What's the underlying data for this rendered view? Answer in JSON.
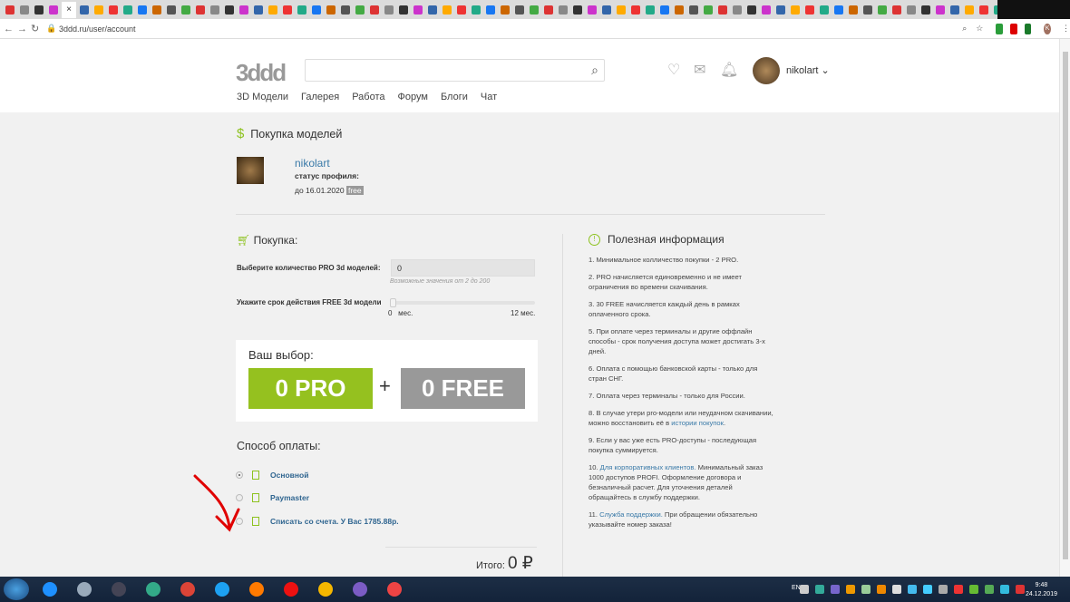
{
  "browser": {
    "url": "3ddd.ru/user/account",
    "active_tab_close": "×",
    "new_tab": "+",
    "profile_initial": "K"
  },
  "header": {
    "logo": "3ddd",
    "search_placeholder": "",
    "username": "nikolart",
    "menu": [
      "3D Модели",
      "Галерея",
      "Работа",
      "Форум",
      "Блоги",
      "Чат"
    ]
  },
  "page": {
    "title": "Покупка моделей",
    "profile": {
      "name": "nikolart",
      "status_label": "статус профиля:",
      "until": "до 16.01.2020",
      "badge": "free"
    }
  },
  "purchase": {
    "title": "Покупка:",
    "pro_label": "Выберите количество PRO 3d моделей:",
    "pro_value": "0",
    "pro_hint": "Возможные значения от 2 до 200",
    "free_label": "Укажите срок действия FREE 3d модели",
    "slider_min": "0",
    "slider_min_unit": "мес.",
    "slider_max": "12 мес.",
    "slider_value": 0
  },
  "choice": {
    "title": "Ваш выбор:",
    "pro": "0 PRO",
    "plus": "+",
    "free": "0 FREE"
  },
  "payment": {
    "title": "Способ оплаты:",
    "options": [
      {
        "label": "Основной",
        "selected": true
      },
      {
        "label": "Paymaster",
        "selected": false
      },
      {
        "label": "Списать со счета. У Вас 1785.88р.",
        "selected": false
      }
    ],
    "total_label": "Итого:",
    "total_value": "0 ₽"
  },
  "info": {
    "title": "Полезная информация",
    "items": [
      {
        "text": "1. Минимальное колличество покупки - 2 PRO."
      },
      {
        "text": "2. PRO начисляется единовременно и не имеет ограничения во времени скачивания."
      },
      {
        "text": "3. 30 FREE начисляется каждый день в рамках оплаченного срока."
      },
      {
        "text": "5. При оплате через терминалы и другие оффлайн способы - срок получения доступа может достигать 3-х дней."
      },
      {
        "text": "6. Оплата с помощью банковской карты - только для стран СНГ."
      },
      {
        "text": "7. Оплата через терминалы - только для России."
      },
      {
        "text": "8. В случае утери pro-модели или неудачном скачивании, можно восстановить её в ",
        "link": "истории покупок",
        "after": "."
      },
      {
        "text": "9. Если у вас уже есть PRO-доступы - последующая покупка суммируется."
      },
      {
        "text": "10. ",
        "link": "Для корпоративных клиентов.",
        "after": " Минимальный заказ 1000 доступов PROFI. Оформление договора и безналичный расчет. Для уточнения деталей обращайтесь в службу поддержки."
      },
      {
        "text": "11. ",
        "link": "Служба поддержки.",
        "after": " При обращении обязательно указывайте номер заказа!"
      }
    ]
  },
  "taskbar": {
    "lang": "EN",
    "time": "9:48",
    "date": "24.12.2019"
  },
  "colors": {
    "accent": "#95c11f",
    "free": "#999999",
    "link": "#3a7aa8",
    "annotation": "#e00000"
  }
}
